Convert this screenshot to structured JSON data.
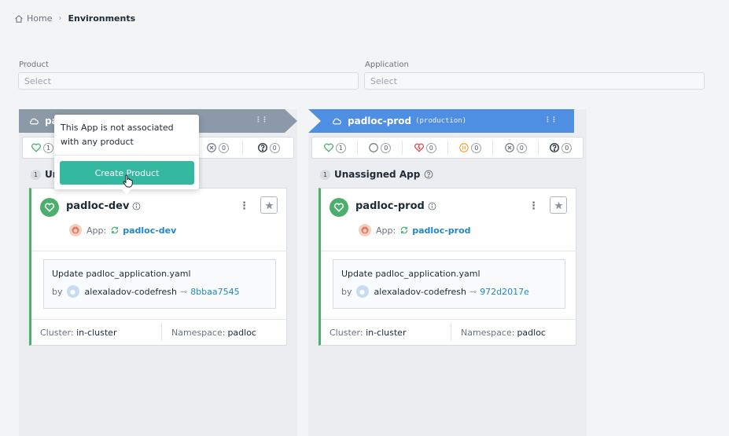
{
  "breadcrumb": {
    "home": "Home",
    "separator": "›",
    "current": "Environments"
  },
  "filters": {
    "product": {
      "label": "Product",
      "placeholder": "Select"
    },
    "application": {
      "label": "Application",
      "placeholder": "Select"
    }
  },
  "colors": {
    "dev_header": "#8b99a8",
    "prod_header": "#4f8fe3",
    "healthy": "#4caf6e",
    "link": "#1e88c8",
    "button": "#34b9a0"
  },
  "environments": [
    {
      "name": "pa",
      "type": "",
      "statuses": [
        {
          "icon": "heart-icon",
          "count": "1"
        },
        {
          "icon": "error-circle-icon",
          "count": "0"
        },
        {
          "icon": "question-circle-icon",
          "count": "0"
        }
      ],
      "section": {
        "count": "1",
        "title": "Ur"
      },
      "app": {
        "name": "padloc-dev",
        "app_label": "App:",
        "app_link": "padloc-dev",
        "commit_message": "Update padloc_application.yaml",
        "by_label": "by",
        "author": "alexaladov-codefresh",
        "arrow": "⊸",
        "sha": "8bbaa7545",
        "cluster_label": "Cluster:",
        "cluster": "in-cluster",
        "namespace_label": "Namespace:",
        "namespace": "padloc"
      }
    },
    {
      "name": "padloc-prod",
      "type": "(production)",
      "statuses": [
        {
          "icon": "heart-icon",
          "count": "1"
        },
        {
          "icon": "progressing-circle-icon",
          "count": "0"
        },
        {
          "icon": "broken-heart-icon",
          "count": "0"
        },
        {
          "icon": "pause-circle-icon",
          "count": "0"
        },
        {
          "icon": "error-circle-icon",
          "count": "0"
        },
        {
          "icon": "question-circle-icon",
          "count": "0"
        }
      ],
      "section": {
        "count": "1",
        "title": "Unassigned App"
      },
      "app": {
        "name": "padloc-prod",
        "app_label": "App:",
        "app_link": "padloc-prod",
        "commit_message": "Update padloc_application.yaml",
        "by_label": "by",
        "author": "alexaladov-codefresh",
        "arrow": "⊸",
        "sha": "972d2017e",
        "cluster_label": "Cluster:",
        "cluster": "in-cluster",
        "namespace_label": "Namespace:",
        "namespace": "padloc"
      }
    }
  ],
  "tooltip": {
    "text": "This App is not associated with any product",
    "button": "Create Product"
  }
}
